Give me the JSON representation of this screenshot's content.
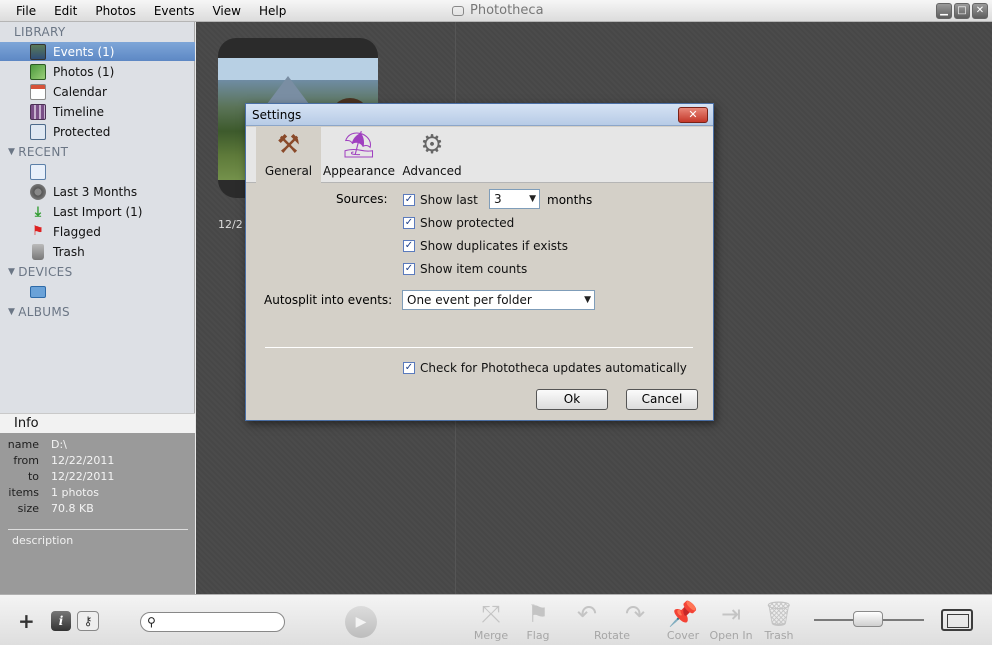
{
  "app": {
    "title": "Phototheca",
    "menu": [
      "File",
      "Edit",
      "Photos",
      "Events",
      "View",
      "Help"
    ],
    "window_buttons": {
      "minimize": "▁",
      "maximize": "□",
      "close": "✕"
    }
  },
  "sidebar": {
    "library": {
      "header": "LIBRARY",
      "items": [
        {
          "label": "Events (1)",
          "icon": "events-icon",
          "selected": true
        },
        {
          "label": "Photos (1)",
          "icon": "photos-icon"
        },
        {
          "label": "Calendar",
          "icon": "calendar-icon"
        },
        {
          "label": "Timeline",
          "icon": "timeline-icon"
        },
        {
          "label": "Protected",
          "icon": "protected-icon"
        }
      ]
    },
    "recent": {
      "header": "RECENT",
      "items": [
        {
          "label": "",
          "icon": "recent-folder-icon"
        },
        {
          "label": "Last 3 Months",
          "icon": "clock-icon"
        },
        {
          "label": "Last Import (1)",
          "icon": "import-icon"
        },
        {
          "label": "Flagged",
          "icon": "flag-icon"
        },
        {
          "label": "Trash",
          "icon": "trash-icon"
        }
      ]
    },
    "devices": {
      "header": "DEVICES",
      "items": [
        {
          "label": "",
          "icon": "device-icon"
        }
      ]
    },
    "albums": {
      "header": "ALBUMS"
    }
  },
  "info": {
    "header": "Info",
    "rows": [
      {
        "key": "name",
        "value": "D:\\"
      },
      {
        "key": "from",
        "value": "12/22/2011"
      },
      {
        "key": "to",
        "value": "12/22/2011"
      },
      {
        "key": "items",
        "value": "1 photos"
      },
      {
        "key": "size",
        "value": "70.8 KB"
      }
    ],
    "description_placeholder": "description"
  },
  "main": {
    "event_date": "12/2"
  },
  "toolbar": {
    "search_placeholder": "",
    "actions": [
      {
        "label": "Merge",
        "icon": "merge-icon",
        "glyph": "⤧"
      },
      {
        "label": "Flag",
        "icon": "flag-icon",
        "glyph": "⚑"
      },
      {
        "label": "Rotate",
        "icon": "rotate-left-icon",
        "glyph": "↶"
      },
      {
        "label": "",
        "icon": "rotate-right-icon",
        "glyph": "↷"
      },
      {
        "label": "Cover",
        "icon": "cover-pin-icon",
        "glyph": "📌"
      },
      {
        "label": "Open In",
        "icon": "open-in-icon",
        "glyph": "⇥"
      },
      {
        "label": "Trash",
        "icon": "trash-icon",
        "glyph": "🗑"
      }
    ]
  },
  "dialog": {
    "title": "Settings",
    "tabs": [
      {
        "label": "General",
        "icon": "tools-icon",
        "active": true
      },
      {
        "label": "Appearance",
        "icon": "paint-bucket-icon"
      },
      {
        "label": "Advanced",
        "icon": "gear-icon"
      }
    ],
    "sources_label": "Sources:",
    "show_last_label": "Show last",
    "show_last_value": "3",
    "months_label": "months",
    "checkboxes": [
      {
        "label": "Show last",
        "checked": true
      },
      {
        "label": "Show protected",
        "checked": true
      },
      {
        "label": "Show duplicates if exists",
        "checked": true
      },
      {
        "label": "Show item counts",
        "checked": true
      }
    ],
    "autosplit_label": "Autosplit into events:",
    "autosplit_value": "One event per folder",
    "updates_label": "Check for Phototheca updates automatically",
    "updates_checked": true,
    "ok_label": "Ok",
    "cancel_label": "Cancel"
  },
  "colors": {
    "selection": "#5d88c4",
    "sidebar_bg": "#dde0e5",
    "main_bg": "#4a4a4a",
    "dialog_bg": "#d4d0c8"
  }
}
